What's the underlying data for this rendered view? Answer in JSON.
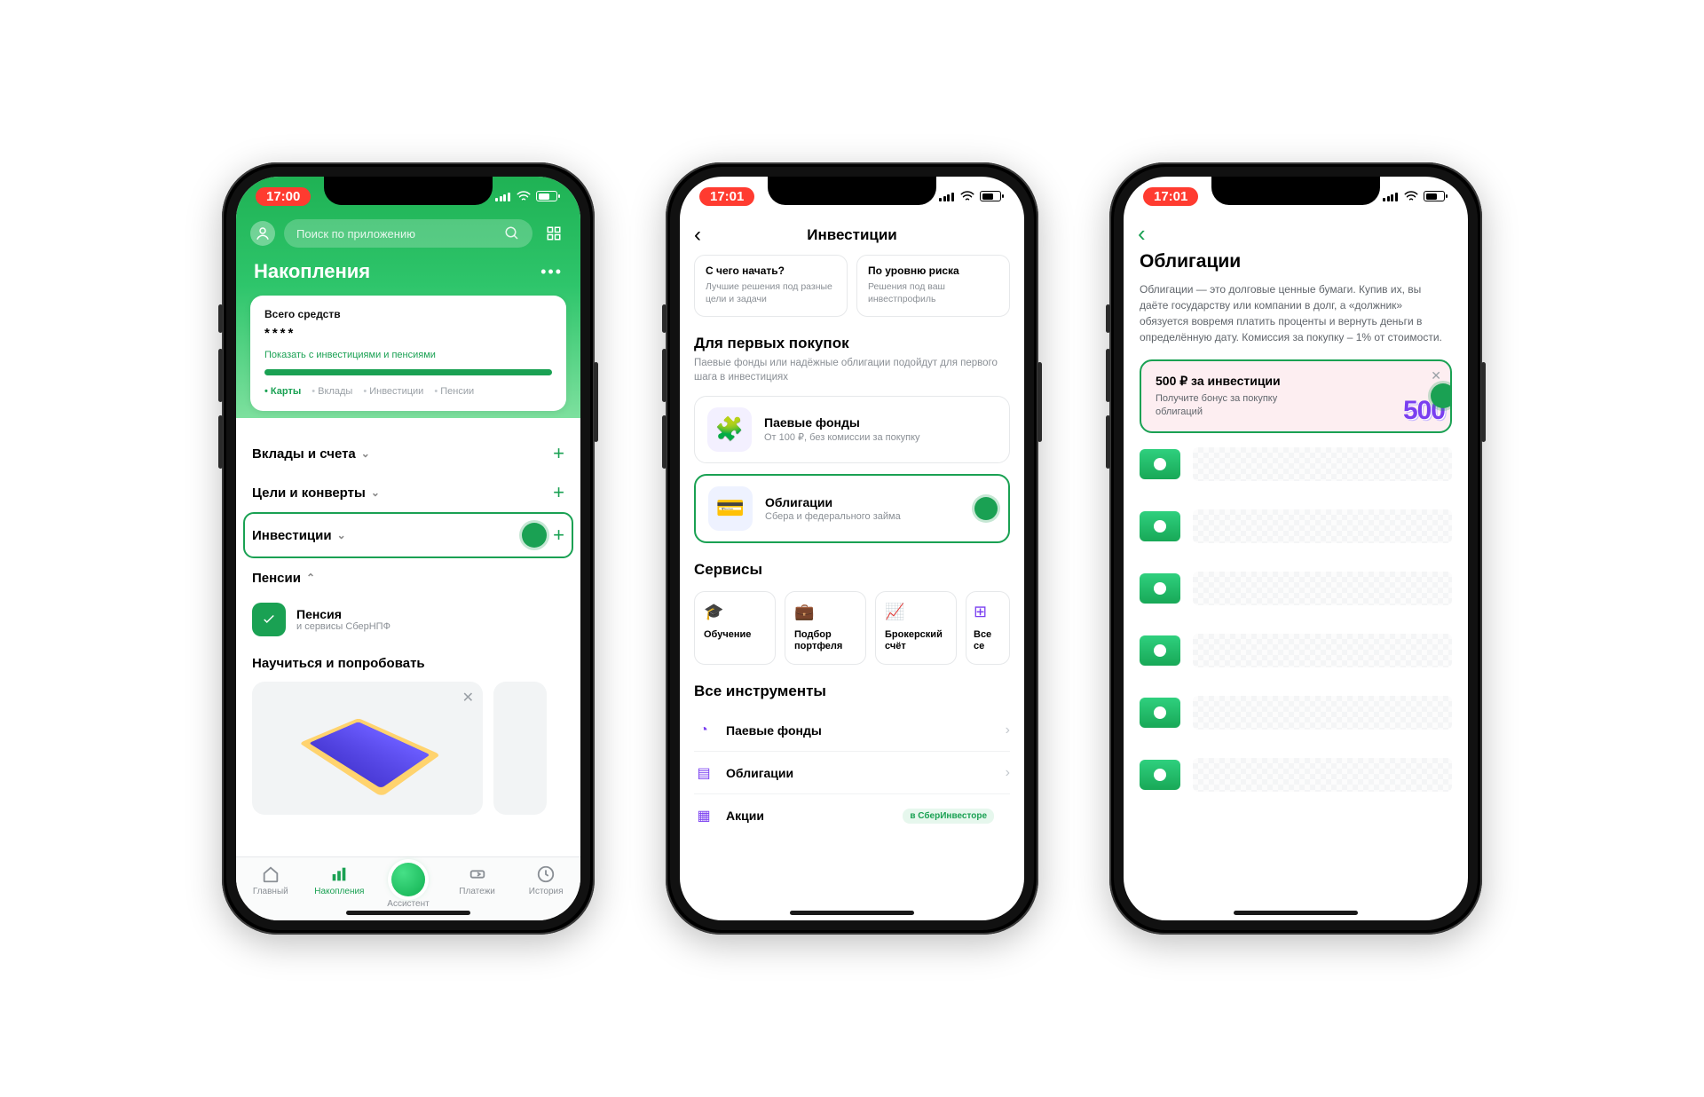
{
  "screen1": {
    "time": "17:00",
    "search_placeholder": "Поиск по приложению",
    "title": "Накопления",
    "funds_label": "Всего средств",
    "funds_value": "****",
    "funds_link": "Показать с инвестициями и пенсиями",
    "funds_tabs": {
      "cards": "Карты",
      "deposits": "Вклады",
      "invest": "Инвестиции",
      "pension": "Пенсии"
    },
    "sect_deposits": "Вклады и счета",
    "sect_goals": "Цели и конверты",
    "sect_invest": "Инвестиции",
    "sect_pension": "Пенсии",
    "pension_item_title": "Пенсия",
    "pension_item_sub": "и сервисы СберНПФ",
    "learn_heading": "Научиться и попробовать",
    "tabs": {
      "home": "Главный",
      "savings": "Накопления",
      "assistant": "Ассистент",
      "payments": "Платежи",
      "history": "История"
    }
  },
  "screen2": {
    "time": "17:01",
    "title": "Инвестиции",
    "suggest1_h": "С чего начать?",
    "suggest1_d": "Лучшие решения под разные цели и задачи",
    "suggest2_h": "По уровню риска",
    "suggest2_d": "Решения под ваш инвестпрофиль",
    "first_h": "Для первых покупок",
    "first_d": "Паевые фонды или надёжные облигации подойдут для первого шага в инвестициях",
    "prod_funds_t": "Паевые фонды",
    "prod_funds_d": "От 100 ₽, без комиссии за покупку",
    "prod_bonds_t": "Облигации",
    "prod_bonds_d": "Сбера и федерального займа",
    "svc_h": "Сервисы",
    "svc": {
      "edu": "Обучение",
      "portfolio": "Подбор портфеля",
      "broker": "Брокерский счёт",
      "all": "Все се"
    },
    "all_h": "Все инструменты",
    "instr": {
      "funds": "Паевые фонды",
      "bonds": "Облигации",
      "stocks": "Акции"
    },
    "badge": "в СберИнвесторе"
  },
  "screen3": {
    "time": "17:01",
    "title": "Облигации",
    "desc": "Облигации — это долговые ценные бумаги. Купив их, вы даёте государству или компании в долг, а «должник» обязуется вовремя платить проценты и вернуть деньги в определённую дату. Комиссия за покупку – 1% от стоимости.",
    "promo_t": "500 ₽ за инвестиции",
    "promo_d": "Получите бонус за покупку облигаций",
    "promo_num": "500"
  }
}
